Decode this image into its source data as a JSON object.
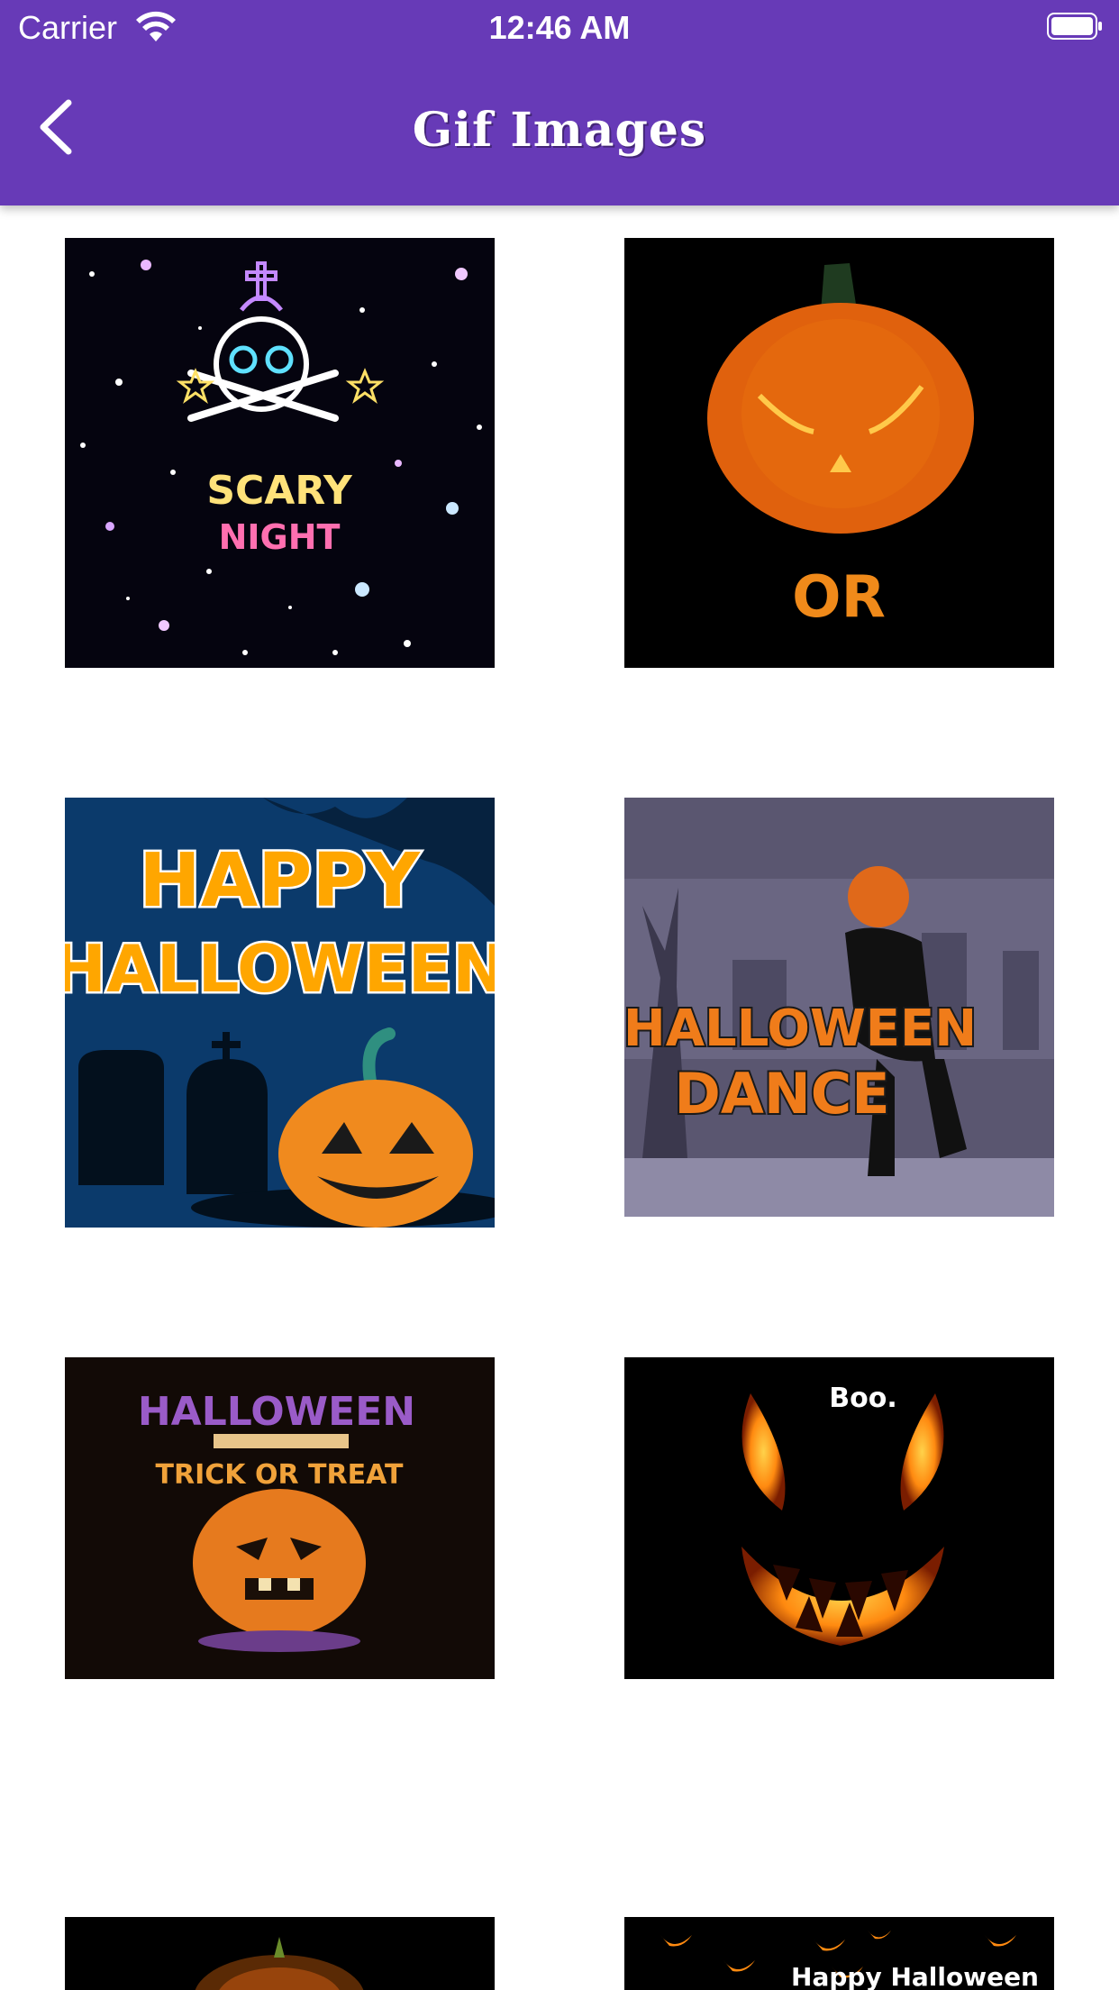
{
  "status_bar": {
    "carrier": "Carrier",
    "time": "12:46 AM"
  },
  "nav": {
    "title": "Gif Images"
  },
  "images": [
    {
      "name": "scary-night",
      "line1": "SCARY",
      "line2": "NIGHT"
    },
    {
      "name": "pumpkin-or",
      "line1": "OR"
    },
    {
      "name": "happy-halloween",
      "line1": "HAPPY",
      "line2": "HALLOWEEN"
    },
    {
      "name": "halloween-dance",
      "line1": "HALLOWEEN",
      "line2": "DANCE"
    },
    {
      "name": "halloween-trick-or-treat",
      "line1": "HALLOWEEN",
      "line2": "TRICK OR TREAT"
    },
    {
      "name": "boo-pumpkin",
      "line1": "Boo."
    },
    {
      "name": "glowing-pumpkin"
    },
    {
      "name": "happy-halloween-faces",
      "line1": "Happy Halloween"
    }
  ]
}
